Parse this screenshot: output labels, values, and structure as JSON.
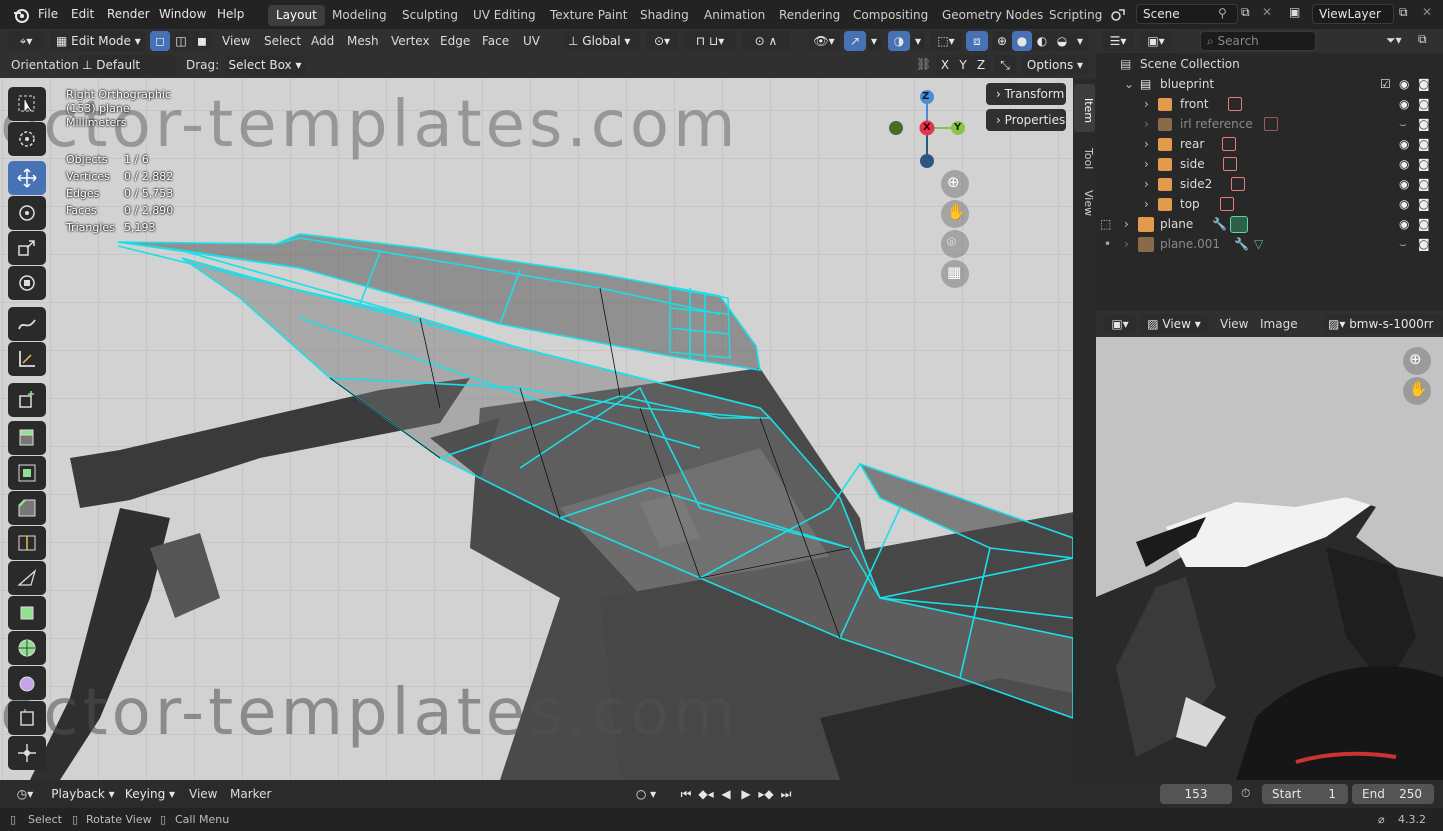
{
  "menu": [
    "File",
    "Edit",
    "Render",
    "Window",
    "Help"
  ],
  "workspaces": [
    "Layout",
    "Modeling",
    "Sculpting",
    "UV Editing",
    "Texture Paint",
    "Shading",
    "Animation",
    "Rendering",
    "Compositing",
    "Geometry Nodes",
    "Scripting"
  ],
  "scene": {
    "label": "Scene",
    "view_layer": "ViewLayer"
  },
  "viewport_header": {
    "mode": "Edit Mode",
    "menus": [
      "View",
      "Select",
      "Add",
      "Mesh",
      "Vertex",
      "Edge",
      "Face",
      "UV"
    ],
    "transform": "Global",
    "orientation_label": "Orientation:",
    "orientation_value": "Default",
    "drag_label": "Drag:",
    "drag_value": "Select Box",
    "axes": [
      "X",
      "Y",
      "Z"
    ],
    "options": "Options"
  },
  "overlay": {
    "view_name": "Right Orthographic",
    "object": "(153) plane",
    "units": "Millimeters",
    "stats": [
      {
        "label": "Objects",
        "value": "1 / 6"
      },
      {
        "label": "Vertices",
        "value": "0 / 2,882"
      },
      {
        "label": "Edges",
        "value": "0 / 5,753"
      },
      {
        "label": "Faces",
        "value": "0 / 2,890"
      },
      {
        "label": "Triangles",
        "value": "5,193"
      }
    ],
    "watermark": "ector-templates.com"
  },
  "gizmo": {
    "z": "Z",
    "x": "X",
    "y": "Y"
  },
  "npanel": {
    "transform": "Transform",
    "properties": "Properties",
    "tabs": [
      "Item",
      "Tool",
      "View"
    ]
  },
  "outliner": {
    "search_placeholder": "Search",
    "root": "Scene Collection",
    "collection": "blueprint",
    "items": [
      "front",
      "irl reference",
      "rear",
      "side",
      "side2",
      "top"
    ],
    "objects": [
      "plane",
      "plane.001"
    ]
  },
  "image_editor": {
    "view1": "View",
    "view2": "View",
    "image": "Image",
    "image_name": "bmw-s-1000rr"
  },
  "timeline": {
    "playback": "Playback",
    "keying": "Keying",
    "view": "View",
    "marker": "Marker",
    "frame": "153",
    "start_label": "Start",
    "start": "1",
    "end_label": "End",
    "end": "250"
  },
  "status": {
    "select": "Select",
    "rotate": "Rotate View",
    "menu": "Call Menu",
    "version": "4.3.2"
  },
  "colors": {
    "accent": "#4772b3",
    "wire": "#19e0e8",
    "x_axis": "#e8334f",
    "y_axis": "#8bc34a",
    "z_axis": "#4c8cd6"
  }
}
